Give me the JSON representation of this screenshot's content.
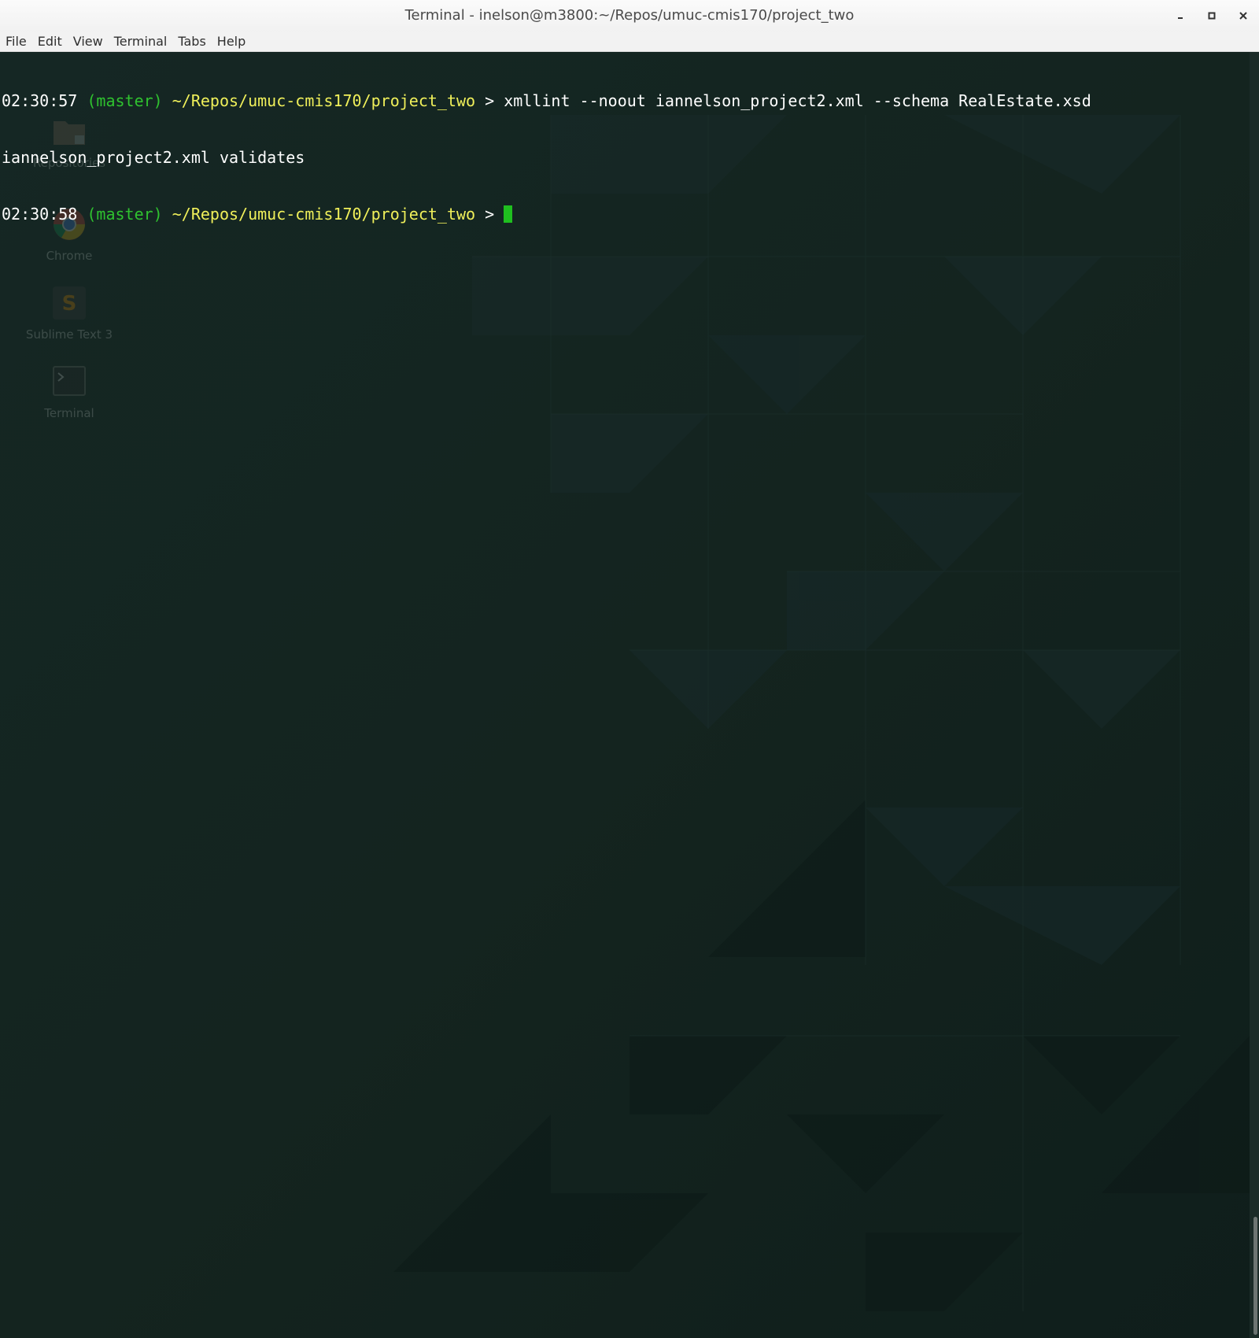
{
  "window": {
    "title": "Terminal - inelson@m3800:~/Repos/umuc-cmis170/project_two"
  },
  "controls": {
    "minimize_icon": "minimize-icon",
    "maximize_icon": "maximize-icon",
    "close_icon": "close-icon"
  },
  "menu": [
    {
      "label": "File"
    },
    {
      "label": "Edit"
    },
    {
      "label": "View"
    },
    {
      "label": "Terminal"
    },
    {
      "label": "Tabs"
    },
    {
      "label": "Help"
    }
  ],
  "desktop": {
    "icons": [
      {
        "label": "Repositories",
        "icon": "folder-icon"
      },
      {
        "label": "Chrome",
        "icon": "chrome-icon"
      },
      {
        "label": "Sublime Text 3",
        "icon": "sublime-text-icon"
      },
      {
        "label": "Terminal",
        "icon": "terminal-icon"
      }
    ]
  },
  "terminal": {
    "lines": [
      {
        "time": "02:30:57",
        "branch": "(master)",
        "path": "~/Repos/umuc-cmis170/project_two",
        "symbol": ">",
        "command": "xmllint --noout iannelson_project2.xml --schema RealEstate.xsd"
      },
      {
        "output": "iannelson_project2.xml validates"
      },
      {
        "time": "02:30:58",
        "branch": "(master)",
        "path": "~/Repos/umuc-cmis170/project_two",
        "symbol": ">"
      }
    ]
  },
  "colors": {
    "background": "#13231f",
    "prompt_time": "#ffffff",
    "prompt_branch": "#2fc22f",
    "prompt_path": "#f0f05a",
    "cursor": "#1fbf1f"
  }
}
